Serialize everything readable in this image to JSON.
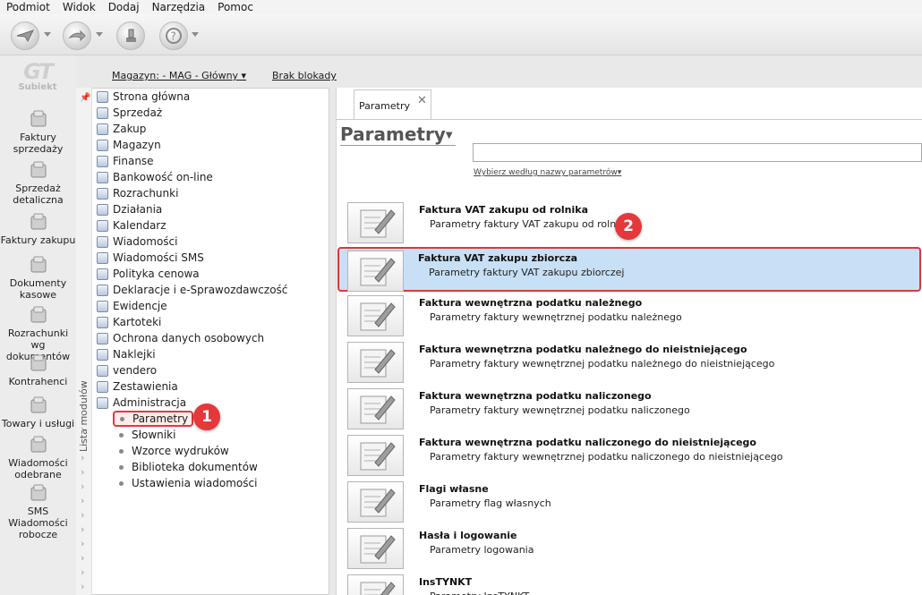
{
  "menu": [
    "Podmiot",
    "Widok",
    "Dodaj",
    "Narzędzia",
    "Pomoc"
  ],
  "logo": {
    "mark": "GT",
    "text": "Subiekt"
  },
  "leftnav": [
    {
      "label": "Faktury\nsprzedaży",
      "icon": "coins-icon"
    },
    {
      "label": "Sprzedaż\ndetaliczna",
      "icon": "bag-icon"
    },
    {
      "label": "Faktury zakupu",
      "icon": "invoice-icon"
    },
    {
      "label": "Dokumenty\nkasowe",
      "icon": "cash-icon"
    },
    {
      "label": "Rozrachunki wg\ndokumentów",
      "icon": "settlement-icon"
    },
    {
      "label": "Kontrahenci",
      "icon": "person-icon"
    },
    {
      "label": "Towary i usługi",
      "icon": "box-icon"
    },
    {
      "label": "Wiadomości\nodebrane",
      "icon": "inbox-icon"
    },
    {
      "label": "SMS\nWiadomości\nrobocze",
      "icon": "sms-icon"
    }
  ],
  "header": {
    "magazyn": "Magazyn: - MAG - Główny",
    "blokady": "Brak blokady"
  },
  "tree": {
    "strip_label": "Lista modułów",
    "items": [
      "Strona główna",
      "Sprzedaż",
      "Zakup",
      "Magazyn",
      "Finanse",
      "Bankowość on-line",
      "Rozrachunki",
      "Działania",
      "Kalendarz",
      "Wiadomości",
      "Wiadomości SMS",
      "Polityka cenowa",
      "Deklaracje i e-Sprawozdawczość",
      "Ewidencje",
      "Kartoteki",
      "Ochrona danych osobowych",
      "Naklejki",
      "vendero",
      "Zestawienia",
      "Administracja"
    ],
    "sub": [
      "Parametry",
      "Słowniki",
      "Wzorce wydruków",
      "Biblioteka dokumentów",
      "Ustawienia wiadomości"
    ]
  },
  "badges": [
    "1",
    "2"
  ],
  "tab": {
    "label": "Parametry",
    "close": "✕"
  },
  "page": {
    "title": "Parametry",
    "search_hint": "Wybierz według nazwy parametrów"
  },
  "params": [
    {
      "title": "Faktura VAT zakupu od rolnika",
      "desc": "Parametry faktury VAT zakupu od rolnika"
    },
    {
      "title": "Faktura VAT zakupu zbiorcza",
      "desc": "Parametry faktury VAT zakupu zbiorczej"
    },
    {
      "title": "Faktura wewnętrzna podatku należnego",
      "desc": "Parametry faktury wewnętrznej podatku należnego"
    },
    {
      "title": "Faktura wewnętrzna podatku należnego do nieistniejącego",
      "desc": "Parametry faktury wewnętrznej podatku należnego do nieistniejącego"
    },
    {
      "title": "Faktura wewnętrzna podatku naliczonego",
      "desc": "Parametry faktury wewnętrznej podatku naliczonego"
    },
    {
      "title": "Faktura wewnętrzna podatku naliczonego do nieistniejącego",
      "desc": "Parametry faktury wewnętrznej podatku naliczonego do nieistniejącego"
    },
    {
      "title": "Flagi własne",
      "desc": "Parametry flag własnych"
    },
    {
      "title": "Hasła i logowanie",
      "desc": "Parametry logowania"
    },
    {
      "title": "InsTYNKT",
      "desc": "Parametry InsTYNKT"
    }
  ]
}
